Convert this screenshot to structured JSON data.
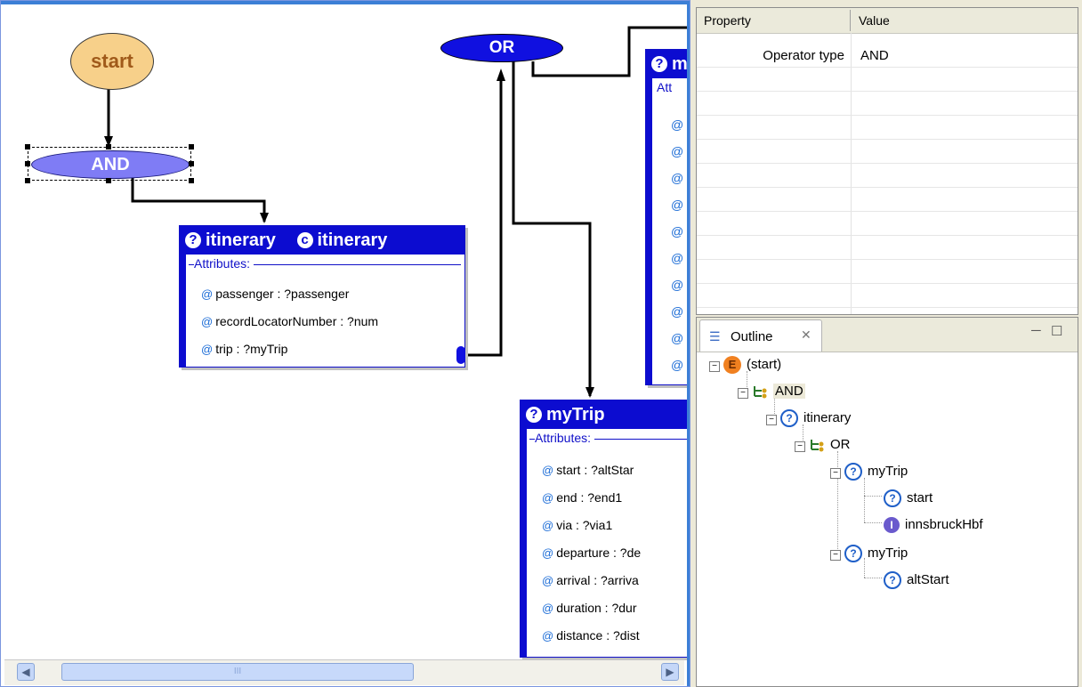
{
  "diagram": {
    "start_node": "start",
    "and_node": "AND",
    "or_node": "OR",
    "itinerary_box": {
      "title": "itinerary",
      "class_name": "itinerary",
      "attributes_header": "Attributes:",
      "attributes": [
        "passenger : ?passenger",
        "recordLocatorNumber : ?num",
        "trip : ?myTrip"
      ]
    },
    "mytrip_box": {
      "title": "myTrip",
      "attributes_header": "Attributes:",
      "attributes": [
        "start : ?altStar",
        "end : ?end1",
        "via : ?via1",
        "departure : ?de",
        "arrival : ?arriva",
        "duration : ?dur",
        "distance : ?dist"
      ]
    },
    "partial_box": {
      "title": "m",
      "attributes_header": "Att"
    },
    "scroll_thumb_grip": "III"
  },
  "properties": {
    "columns": [
      "Property",
      "Value"
    ],
    "rows": [
      {
        "key": "Operator type",
        "value": "AND"
      }
    ]
  },
  "outline": {
    "tab_label": "Outline",
    "tree": [
      {
        "label": "(start)",
        "icon": "event-icon"
      },
      {
        "label": "AND",
        "icon": "operator-icon",
        "selected": true
      },
      {
        "label": "itinerary",
        "icon": "question-icon"
      },
      {
        "label": "OR",
        "icon": "operator-icon"
      },
      {
        "label": "myTrip",
        "icon": "question-icon"
      },
      {
        "label": "start",
        "icon": "question-icon"
      },
      {
        "label": "innsbruckHbf",
        "icon": "instance-icon"
      },
      {
        "label": "myTrip",
        "icon": "question-icon"
      },
      {
        "label": "altStart",
        "icon": "question-icon"
      }
    ]
  }
}
